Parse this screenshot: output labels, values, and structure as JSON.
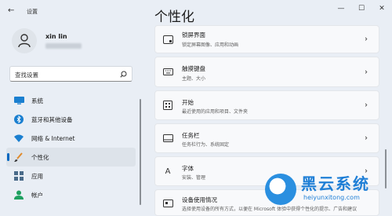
{
  "app": {
    "title": "设置"
  },
  "user": {
    "name": "xin lin"
  },
  "search": {
    "placeholder": "查找设置"
  },
  "sidebar": {
    "items": [
      {
        "label": "系统",
        "icon": "monitor-icon"
      },
      {
        "label": "蓝牙和其他设备",
        "icon": "bluetooth-icon"
      },
      {
        "label": "网络 & Internet",
        "icon": "wifi-icon"
      },
      {
        "label": "个性化",
        "icon": "brush-icon",
        "active": true
      },
      {
        "label": "应用",
        "icon": "apps-icon"
      },
      {
        "label": "帐户",
        "icon": "account-icon"
      }
    ]
  },
  "main": {
    "title": "个性化",
    "cards": [
      {
        "title": "锁屏界面",
        "subtitle": "锁定屏幕图像、应用和动画",
        "icon": "lock-screen-icon"
      },
      {
        "title": "触摸键盘",
        "subtitle": "主题、大小",
        "icon": "keyboard-icon"
      },
      {
        "title": "开始",
        "subtitle": "最近使用的应用和项目、文件夹",
        "icon": "start-icon"
      },
      {
        "title": "任务栏",
        "subtitle": "任务栏行为、系统固定",
        "icon": "taskbar-icon"
      },
      {
        "title": "字体",
        "subtitle": "安装、管理",
        "icon": "font-icon"
      },
      {
        "title": "设备使用情况",
        "subtitle": "选择使用设备的所有方式，以便在 Microsoft 体验中获得个性化的提示、广告和建议",
        "icon": "device-usage-icon"
      }
    ]
  },
  "watermark": {
    "text": "黑云系统",
    "url": "heiyunxitong.com"
  },
  "colors": {
    "accent": "#0067c0",
    "background": "#e9eef5",
    "card": "#f8f9fb"
  }
}
